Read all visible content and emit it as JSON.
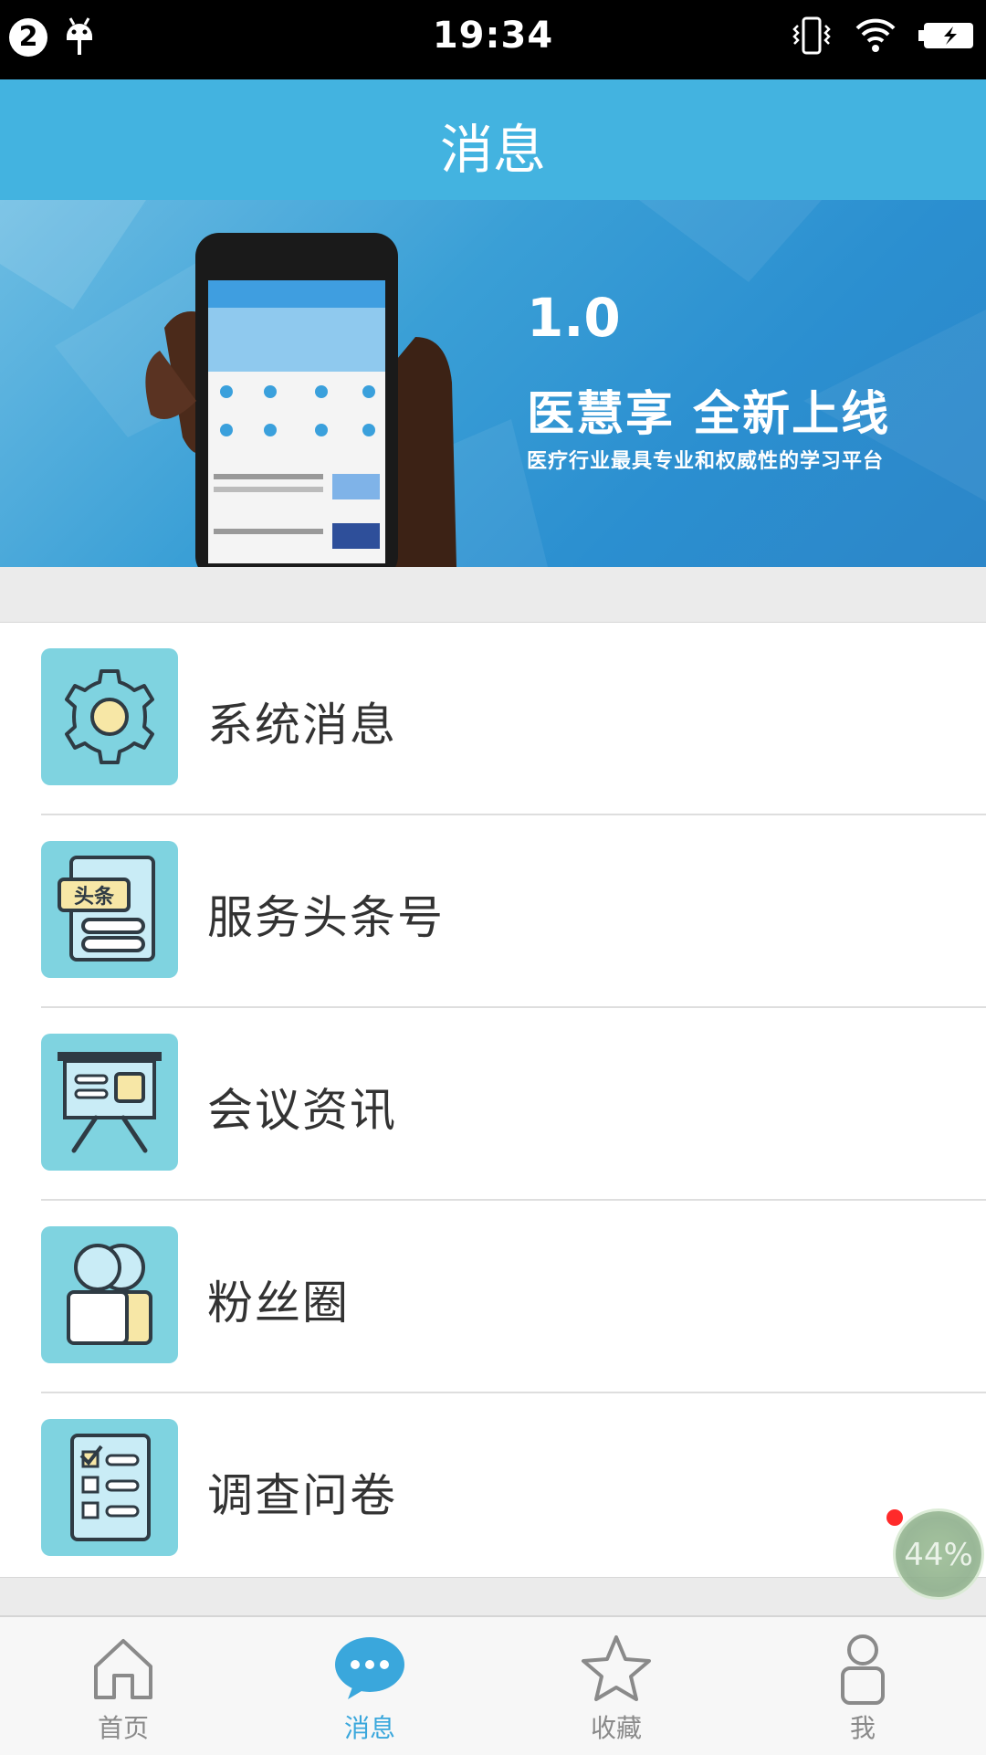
{
  "status_bar": {
    "notification_count": "2",
    "time": "19:34",
    "icons": [
      "android-icon",
      "vibrate-icon",
      "wifi-icon",
      "battery-icon"
    ]
  },
  "header": {
    "title": "消息"
  },
  "banner": {
    "version": "1.0",
    "headline": "医慧享  全新上线",
    "subtitle": "医疗行业最具专业和权威性的学习平台"
  },
  "menu": {
    "items": [
      {
        "label": "系统消息",
        "icon": "gear-icon"
      },
      {
        "label": "服务头条号",
        "icon": "headline-document-icon",
        "icon_text": "头条"
      },
      {
        "label": "会议资讯",
        "icon": "presentation-board-icon"
      },
      {
        "label": "粉丝圈",
        "icon": "users-icon"
      },
      {
        "label": "调查问卷",
        "icon": "checklist-icon"
      }
    ]
  },
  "floating_progress": {
    "percent": "44%",
    "level": 0.44
  },
  "tab_bar": {
    "tabs": [
      {
        "label": "首页",
        "icon": "home-icon",
        "active": false
      },
      {
        "label": "消息",
        "icon": "chat-bubble-icon",
        "active": true
      },
      {
        "label": "收藏",
        "icon": "star-icon",
        "active": false
      },
      {
        "label": "我",
        "icon": "person-icon",
        "active": false
      }
    ]
  },
  "colors": {
    "header_bg": "#43b3e0",
    "icon_tile_bg": "#7fd3e0",
    "active_tab": "#3aa7dc",
    "inactive_tab": "#8a8a8a"
  }
}
